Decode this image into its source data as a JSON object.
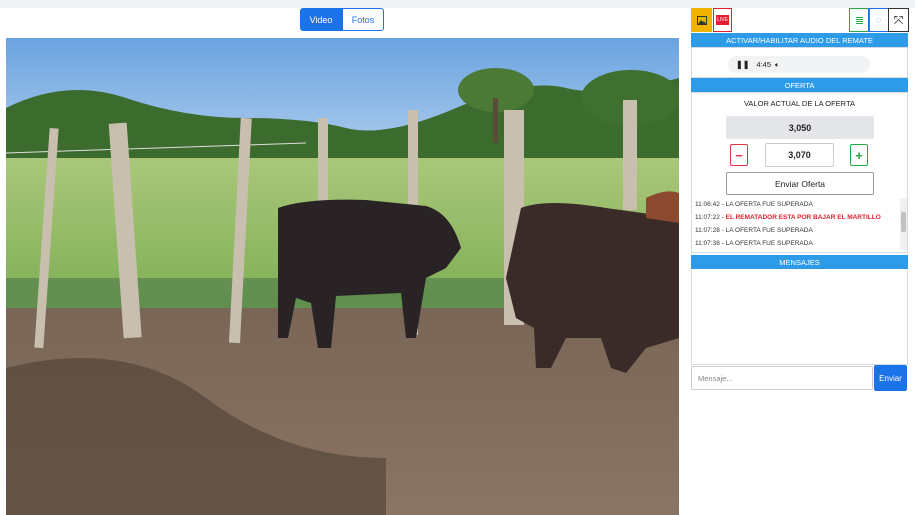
{
  "media_tabs": {
    "video": "Video",
    "photos": "Fotos"
  },
  "live_badge": "LIVE",
  "audio": {
    "title": "ACTIVAR/HABILITAR AUDIO DEL REMATE",
    "time": "4:45"
  },
  "offer": {
    "header": "OFERTA",
    "current_label": "VALOR ACTUAL DE LA OFERTA",
    "current_value": "3,050",
    "bid_value": "3,070",
    "minus_label": "−",
    "plus_label": "+",
    "send_label": "Enviar Oferta"
  },
  "log": [
    {
      "time": "11:06:42",
      "sep": " - ",
      "text": "LA OFERTA FUE SUPERADA",
      "highlight": false
    },
    {
      "time": "11:07:22",
      "sep": " - ",
      "text": "EL REMATADOR ESTA POR BAJAR EL MARTILLO",
      "highlight": true
    },
    {
      "time": "11:07:28",
      "sep": " - ",
      "text": "LA OFERTA FUE SUPERADA",
      "highlight": false
    },
    {
      "time": "11:07:38",
      "sep": " - ",
      "text": "LA OFERTA FUE SUPERADA",
      "highlight": false
    }
  ],
  "messages": {
    "header": "MENSAJES",
    "placeholder": "Mensaje...",
    "send_label": "Enviar"
  },
  "colors": {
    "primary": "#1a73e8",
    "header": "#2d9be8",
    "alert_red": "#e0202f",
    "minus_red": "#dc3545",
    "plus_green": "#28a745",
    "photo_icon_bg": "#f0b400"
  },
  "icons": [
    "image-icon",
    "live-icon",
    "list-icon",
    "chat-icon",
    "expand-icon",
    "pause-icon",
    "volume-icon"
  ]
}
